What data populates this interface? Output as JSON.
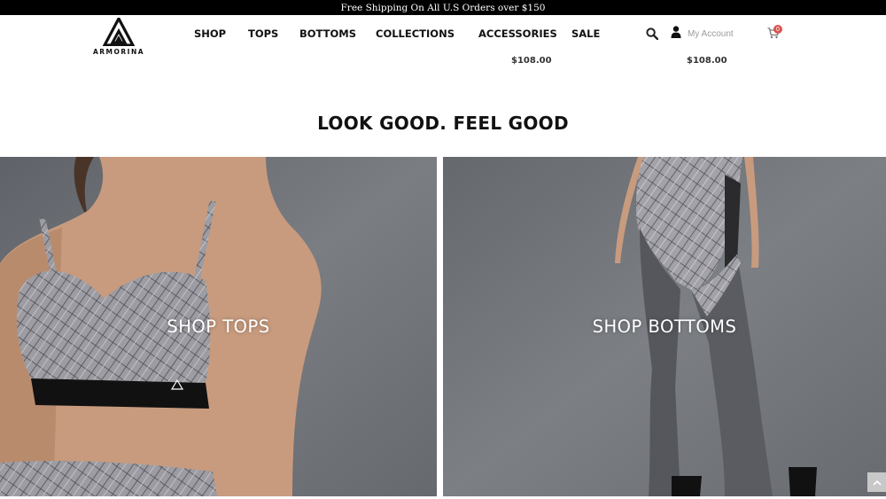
{
  "promo": {
    "text": "Free Shipping  On All  U.S Orders over $150"
  },
  "brand": {
    "name": "ARMORINA"
  },
  "nav": {
    "items": [
      {
        "label": "SHOP"
      },
      {
        "label": "TOPS"
      },
      {
        "label": "BOTTOMS"
      },
      {
        "label": "COLLECTIONS"
      },
      {
        "label": "ACCESSORIES"
      },
      {
        "label": "SALE"
      }
    ]
  },
  "header_icons": {
    "search": "search-icon",
    "account": "user-icon",
    "account_label": "My Account",
    "cart": "cart-icon",
    "cart_count": "0"
  },
  "products": {
    "prices": [
      "$108.00",
      "$108.00"
    ]
  },
  "section": {
    "heading": "LOOK GOOD. FEEL GOOD"
  },
  "tiles": [
    {
      "label": "SHOP TOPS"
    },
    {
      "label": "SHOP BOTTOMS"
    }
  ],
  "colors": {
    "promo_bar": "#000000",
    "badge": "#d9534f",
    "tile_bg": "#6f7277"
  }
}
